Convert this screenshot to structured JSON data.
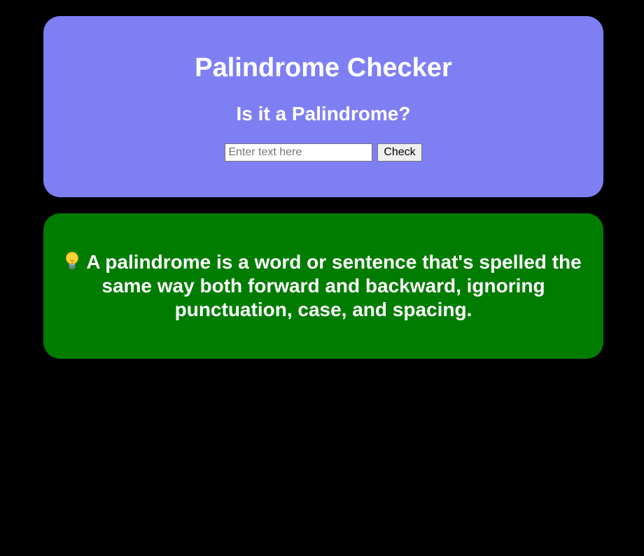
{
  "checker": {
    "title": "Palindrome Checker",
    "subtitle": "Is it a Palindrome?",
    "input": {
      "value": "",
      "placeholder": "Enter text here"
    },
    "check_button_label": "Check"
  },
  "info": {
    "icon": "lightbulb-icon",
    "text": "A palindrome is a word or sentence that's spelled the same way both forward and backward, ignoring punctuation, case, and spacing."
  },
  "colors": {
    "page_background": "#000000",
    "checker_card": "#7f7ff4",
    "info_card": "#007c00",
    "text": "#ffffff"
  }
}
